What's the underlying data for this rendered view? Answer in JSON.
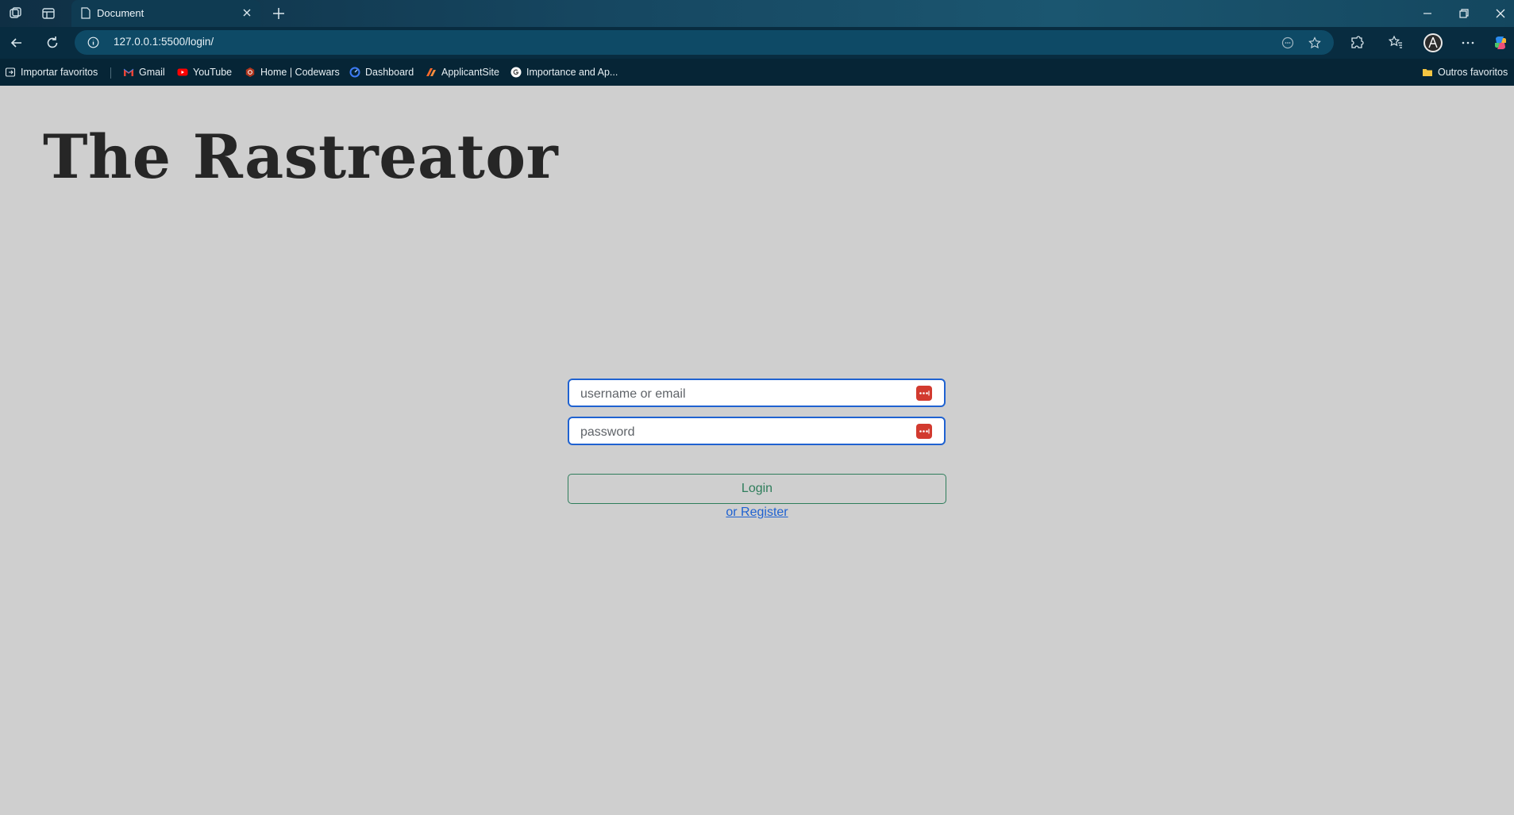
{
  "browser": {
    "tab_title": "Document",
    "address": "127.0.0.1:5500/login/",
    "bookmarks": [
      {
        "label": "Importar favoritos",
        "icon": "import-icon"
      },
      {
        "label": "Gmail",
        "icon": "gmail-icon"
      },
      {
        "label": "YouTube",
        "icon": "youtube-icon"
      },
      {
        "label": "Home | Codewars",
        "icon": "codewars-icon"
      },
      {
        "label": "Dashboard",
        "icon": "dashboard-icon"
      },
      {
        "label": "ApplicantSite",
        "icon": "applicantsite-icon"
      },
      {
        "label": "Importance and Ap...",
        "icon": "google-icon"
      }
    ],
    "other_favorites": "Outros favoritos"
  },
  "page": {
    "title": "The Rastreator",
    "form": {
      "username_placeholder": "username or email",
      "password_placeholder": "password",
      "login_label": "Login",
      "register_label": "or Register"
    }
  },
  "colors": {
    "page_bg": "#cfcfcf",
    "input_border": "#1f62d1",
    "login_accent": "#2e7d5b",
    "link": "#1f62d1",
    "password_manager": "#d23a2f"
  }
}
